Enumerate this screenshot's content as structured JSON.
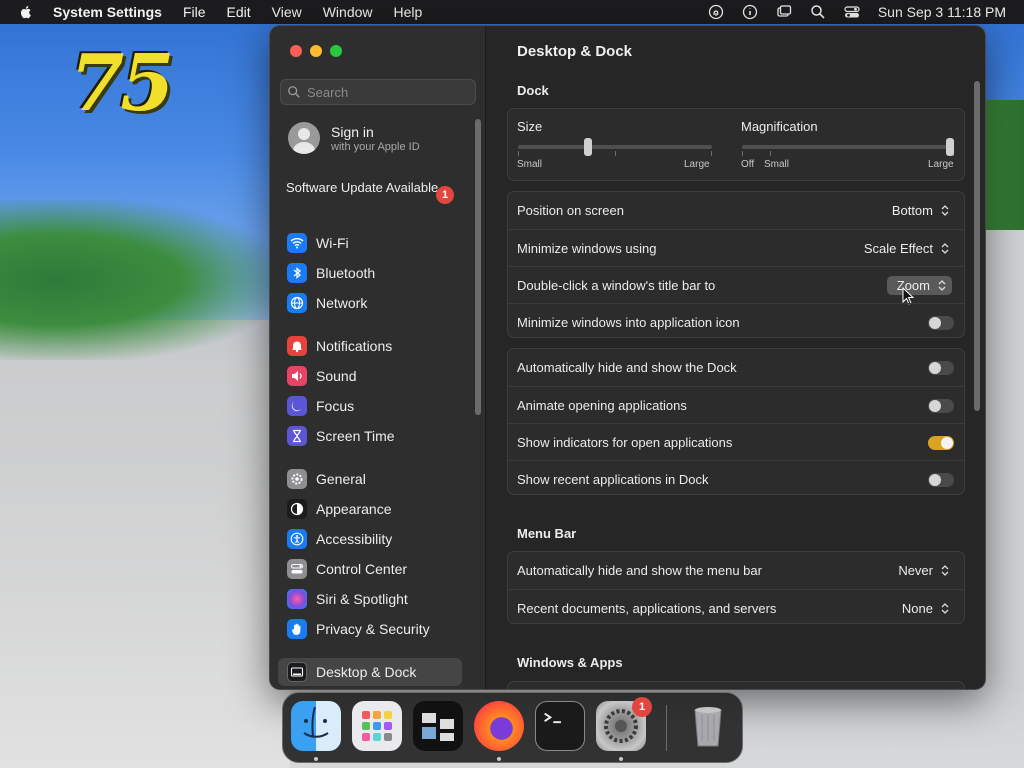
{
  "menubar": {
    "app_name": "System Settings",
    "menus": [
      "File",
      "Edit",
      "View",
      "Window",
      "Help"
    ],
    "clock": "Sun Sep 3  11:18 PM"
  },
  "sidebar": {
    "search_placeholder": "Search",
    "account": {
      "title": "Sign in",
      "subtitle": "with your Apple ID"
    },
    "update": {
      "label": "Software Update Available",
      "badge": "1"
    },
    "items": [
      {
        "label": "Wi-Fi",
        "icon": "wifi-icon",
        "color": "#1a7cf5"
      },
      {
        "label": "Bluetooth",
        "icon": "bluetooth-icon",
        "color": "#1a7cf5"
      },
      {
        "label": "Network",
        "icon": "globe-icon",
        "color": "#1a7cf5"
      },
      {
        "label": "Notifications",
        "icon": "bell-icon",
        "color": "#e9423d"
      },
      {
        "label": "Sound",
        "icon": "speaker-icon",
        "color": "#e64466"
      },
      {
        "label": "Focus",
        "icon": "moon-icon",
        "color": "#5b56d6"
      },
      {
        "label": "Screen Time",
        "icon": "hourglass-icon",
        "color": "#5b56d6"
      },
      {
        "label": "General",
        "icon": "gear-icon",
        "color": "#8e8e93"
      },
      {
        "label": "Appearance",
        "icon": "appearance-icon",
        "color": "#1c1c1e"
      },
      {
        "label": "Accessibility",
        "icon": "accessibility-icon",
        "color": "#1a7cf5"
      },
      {
        "label": "Control Center",
        "icon": "switches-icon",
        "color": "#8e8e93"
      },
      {
        "label": "Siri & Spotlight",
        "icon": "siri-icon",
        "color": "#b04bd6"
      },
      {
        "label": "Privacy & Security",
        "icon": "hand-icon",
        "color": "#1a7cf5"
      },
      {
        "label": "Desktop & Dock",
        "icon": "dock-icon",
        "color": "#1c1c1e"
      }
    ]
  },
  "content": {
    "title": "Desktop & Dock",
    "dock_section": "Dock",
    "size": {
      "label": "Size",
      "min": "Small",
      "max": "Large",
      "value": 0.36
    },
    "magnification": {
      "label": "Magnification",
      "off": "Off",
      "min": "Small",
      "max": "Large",
      "value": 1.0
    },
    "rows1": [
      {
        "label": "Position on screen",
        "value": "Bottom"
      },
      {
        "label": "Minimize windows using",
        "value": "Scale Effect"
      },
      {
        "label": "Double-click a window's title bar to",
        "value": "Zoom"
      },
      {
        "label": "Minimize windows into application icon",
        "toggle": false
      }
    ],
    "rows2": [
      {
        "label": "Automatically hide and show the Dock",
        "toggle": false
      },
      {
        "label": "Animate opening applications",
        "toggle": false
      },
      {
        "label": "Show indicators for open applications",
        "toggle": true
      },
      {
        "label": "Show recent applications in Dock",
        "toggle": false
      }
    ],
    "menubar_section": "Menu Bar",
    "rows3": [
      {
        "label": "Automatically hide and show the menu bar",
        "value": "Never"
      },
      {
        "label": "Recent documents, applications, and servers",
        "value": "None"
      }
    ],
    "windows_section": "Windows & Apps"
  },
  "dock": {
    "apps": [
      {
        "name": "finder-icon",
        "running": true
      },
      {
        "name": "launchpad-icon",
        "running": false
      },
      {
        "name": "app-icon",
        "running": false
      },
      {
        "name": "firefox-icon",
        "running": true
      },
      {
        "name": "terminal-icon",
        "running": false
      },
      {
        "name": "system-settings-icon",
        "running": true,
        "badge": "1"
      },
      {
        "name": "trash-icon",
        "running": false
      }
    ]
  },
  "colors": {
    "accent": "#d8a520",
    "badge": "#e3463f"
  }
}
